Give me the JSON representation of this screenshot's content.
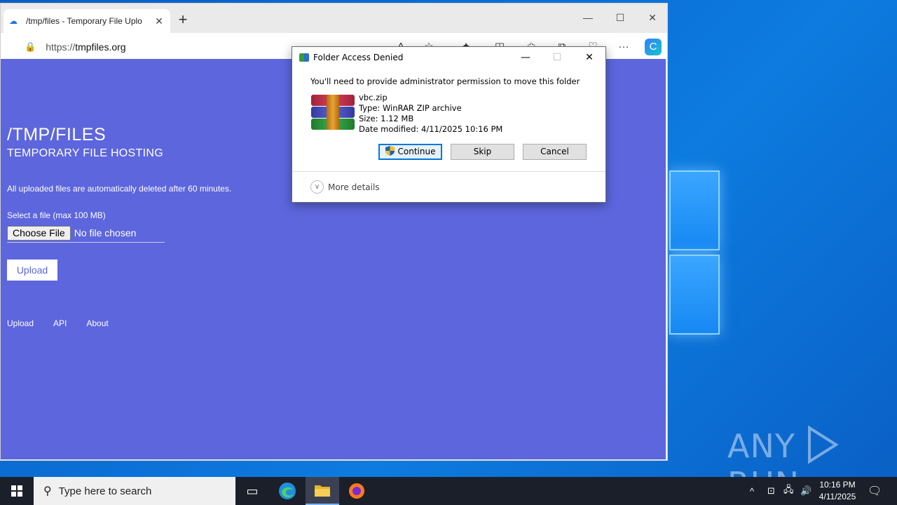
{
  "browser": {
    "tab_title": "/tmp/files - Temporary File Uplo",
    "url_prefix": "https://",
    "url_host": "tmpfiles.org",
    "new_tab": "+",
    "close_tab": "✕"
  },
  "page": {
    "title": "/TMP/FILES",
    "subtitle": "TEMPORARY FILE HOSTING",
    "notice": "All uploaded files are automatically deleted after 60 minutes.",
    "select_label": "Select a file (max 100 MB)",
    "choose_file": "Choose File",
    "no_file": "No file chosen",
    "upload_button": "Upload",
    "nav": [
      "Upload",
      "API",
      "About"
    ]
  },
  "dialog": {
    "title": "Folder Access Denied",
    "message": "You'll need to provide administrator permission to move this folder",
    "file_name": "vbc.zip",
    "file_type": "Type: WinRAR ZIP archive",
    "file_size": "Size: 1.12 MB",
    "file_date": "Date modified: 4/11/2025 10:16 PM",
    "continue": "Continue",
    "skip": "Skip",
    "cancel": "Cancel",
    "more_details": "More details"
  },
  "taskbar": {
    "search_placeholder": "Type here to search",
    "time": "10:16 PM",
    "date": "4/11/2025"
  },
  "watermark": {
    "left": "ANY",
    "right": "RUN"
  },
  "colors": {
    "page_bg": "#5d66dd",
    "accent": "#0078d7",
    "desktop": "#0b6fd6"
  }
}
